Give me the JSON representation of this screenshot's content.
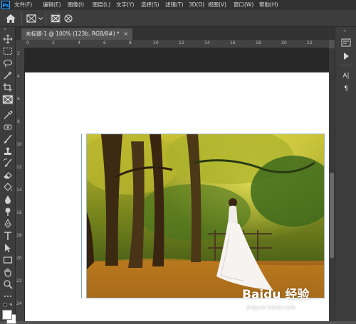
{
  "app": {
    "logo": "Ps"
  },
  "menu": [
    "文件(F)",
    "编辑(E)",
    "图像(I)",
    "图层(L)",
    "文字(Y)",
    "选择(S)",
    "滤镜(T)",
    "3D(D)",
    "视图(V)",
    "窗口(W)",
    "帮助(H)"
  ],
  "document_tab": {
    "title": "未标题-1 @ 100% (123b, RGB/8#) *",
    "close": "×"
  },
  "rulers": {
    "horizontal": [
      "0",
      "2",
      "4",
      "6",
      "8",
      "10",
      "12",
      "14",
      "16",
      "18",
      "20",
      "22"
    ],
    "vertical": [
      "2",
      "4",
      "6",
      "8",
      "10",
      "12",
      "14",
      "16",
      "18",
      "20",
      "22",
      "24"
    ]
  },
  "icons": {
    "home": "home-icon",
    "frame": "frame-tool-icon",
    "options_frame_rect": "rectangular-frame-icon",
    "options_frame_ellipse": "elliptical-frame-icon"
  },
  "right_panel": {
    "paragraph_label": "A|",
    "character_label": "¶"
  },
  "watermark": {
    "brand": "Baidu 经验",
    "url": "jingyan.baidu.com"
  },
  "colors": {
    "accent": "#31a8ff",
    "ui_dark": "#323232",
    "panel": "#3d3d3d"
  }
}
